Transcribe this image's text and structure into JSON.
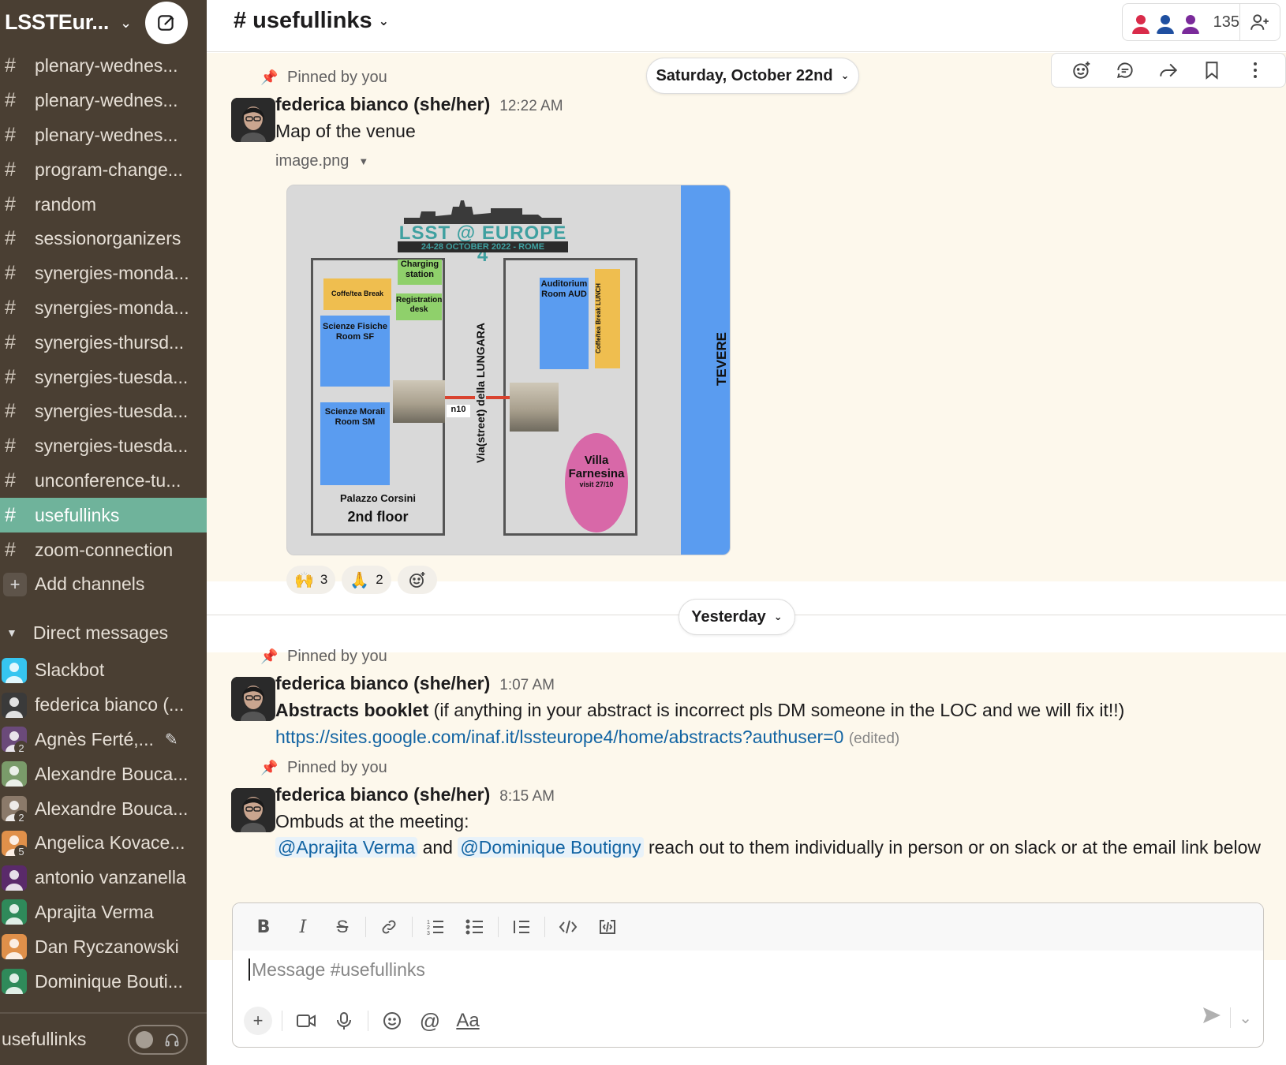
{
  "workspace": {
    "name": "LSSTEur...",
    "chevron": "⌄"
  },
  "sidebar": {
    "channels": [
      {
        "label": "plenary-wednes...",
        "active": false
      },
      {
        "label": "plenary-wednes...",
        "active": false
      },
      {
        "label": "plenary-wednes...",
        "active": false
      },
      {
        "label": "program-change...",
        "active": false
      },
      {
        "label": "random",
        "active": false
      },
      {
        "label": "sessionorganizers",
        "active": false
      },
      {
        "label": "synergies-monda...",
        "active": false
      },
      {
        "label": "synergies-monda...",
        "active": false
      },
      {
        "label": "synergies-thursd...",
        "active": false
      },
      {
        "label": "synergies-tuesda...",
        "active": false
      },
      {
        "label": "synergies-tuesda...",
        "active": false
      },
      {
        "label": "synergies-tuesda...",
        "active": false
      },
      {
        "label": "unconference-tu...",
        "active": false
      },
      {
        "label": "usefullinks",
        "active": true
      },
      {
        "label": "zoom-connection",
        "active": false
      }
    ],
    "add_channels": "Add channels",
    "dm_header": "Direct messages",
    "dms": [
      {
        "label": "Slackbot",
        "badge": "",
        "color": "#36c5f0"
      },
      {
        "label": "federica bianco (...",
        "badge": "",
        "color": "#3a3a3a"
      },
      {
        "label": "Agnès Ferté,...",
        "badge": "2",
        "color": "#6b4a7a",
        "editing": true
      },
      {
        "label": "Alexandre Bouca...",
        "badge": "",
        "color": "#7a9b6a"
      },
      {
        "label": "Alexandre Bouca...",
        "badge": "2",
        "color": "#8b7a6a"
      },
      {
        "label": "Angelica Kovace...",
        "badge": "5",
        "color": "#e0904a"
      },
      {
        "label": "antonio vanzanella",
        "badge": "",
        "color": "#5a2a6a"
      },
      {
        "label": "Aprajita Verma",
        "badge": "",
        "color": "#2f8a5a"
      },
      {
        "label": "Dan Ryczanowski",
        "badge": "",
        "color": "#e0904a"
      },
      {
        "label": "Dominique Bouti...",
        "badge": "",
        "color": "#2f8a5a"
      }
    ],
    "huddle_label": "usefullinks"
  },
  "header": {
    "channel_name": "# usefullinks",
    "member_count": "135"
  },
  "messages": {
    "day1_pill": "Saturday, October 22nd",
    "day2_pill": "Yesterday",
    "m1": {
      "pinned": "Pinned by you",
      "sender": "federica bianco (she/her)",
      "time": "12:22 AM",
      "text": "Map of the venue",
      "file_name": "image.png",
      "reactions": [
        {
          "emoji": "🙌",
          "count": "3"
        },
        {
          "emoji": "🙏",
          "count": "2"
        }
      ]
    },
    "m2": {
      "pinned": "Pinned by you",
      "sender": "federica bianco (she/her)",
      "time": "1:07 AM",
      "bold": "Abstracts booklet",
      "text": " (if anything in your abstract is incorrect pls DM someone in the LOC and we will fix it!!)",
      "link": "https://sites.google.com/inaf.it/lssteurope4/home/abstracts?authuser=0",
      "edited": "(edited)"
    },
    "m3": {
      "pinned": "Pinned by you",
      "sender": "federica bianco (she/her)",
      "time": "8:15 AM",
      "line1": "Ombuds at the meeting:",
      "mention1": "@Aprajita Verma",
      "and": "and",
      "mention2": "@Dominique Boutigny",
      "line2_rest": "reach out to them individually in person or on slack or at the email link below"
    }
  },
  "map_image": {
    "logo_title": "LSST @ EUROPE 4",
    "logo_sub": "24-28 OCTOBER 2022 - ROME",
    "charging": "Charging station",
    "coffee": "Coffe/tea Break",
    "registration": "Registration desk",
    "sf": "Scienze Fisiche Room SF",
    "sm": "Scienze Morali Room SM",
    "n10": "n10",
    "street": "Via(street) della LUNGARA",
    "auditorium": "Auditorium Room AUD",
    "coffee_lunch": "Coffe/tea Break LUNCH",
    "villa": "Villa Farnesina",
    "villa_sub": "visit 27/10",
    "palazzo": "Palazzo Corsini",
    "floor": "2nd floor",
    "river": "TEVERE"
  },
  "composer": {
    "placeholder": "Message #usefullinks"
  },
  "colors": {
    "sidebar_bg": "#4a3f33",
    "active_channel": "#6fb39b",
    "highlight_bg": "#fdf8ec",
    "link": "#1264a3"
  }
}
